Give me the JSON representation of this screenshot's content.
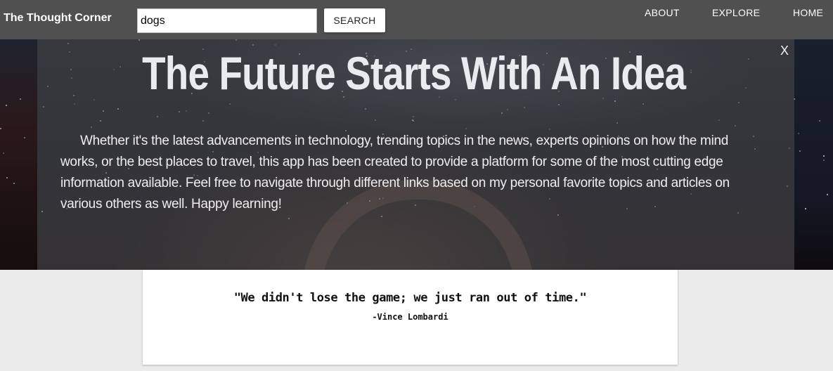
{
  "navbar": {
    "brand": "The Thought Corner",
    "search": {
      "value": "dogs",
      "button_label": "SEARCH"
    },
    "links": [
      "ABOUT",
      "EXPLORE",
      "HOME"
    ]
  },
  "hero": {
    "close_label": "X",
    "title": "The Future Starts With An Idea",
    "description": "Whether it's the latest advancements in technology, trending topics in the news, experts opinions on how the mind works, or the best places to travel, this app has been created to provide a platform for some of the most cutting edge information available. Feel free to navigate through different links based on my personal favorite topics and articles on various others as well. Happy learning!"
  },
  "quote": {
    "text": "\"We didn't lose the game; we just ran out of time.\"",
    "author": "-Vince Lombardi"
  }
}
